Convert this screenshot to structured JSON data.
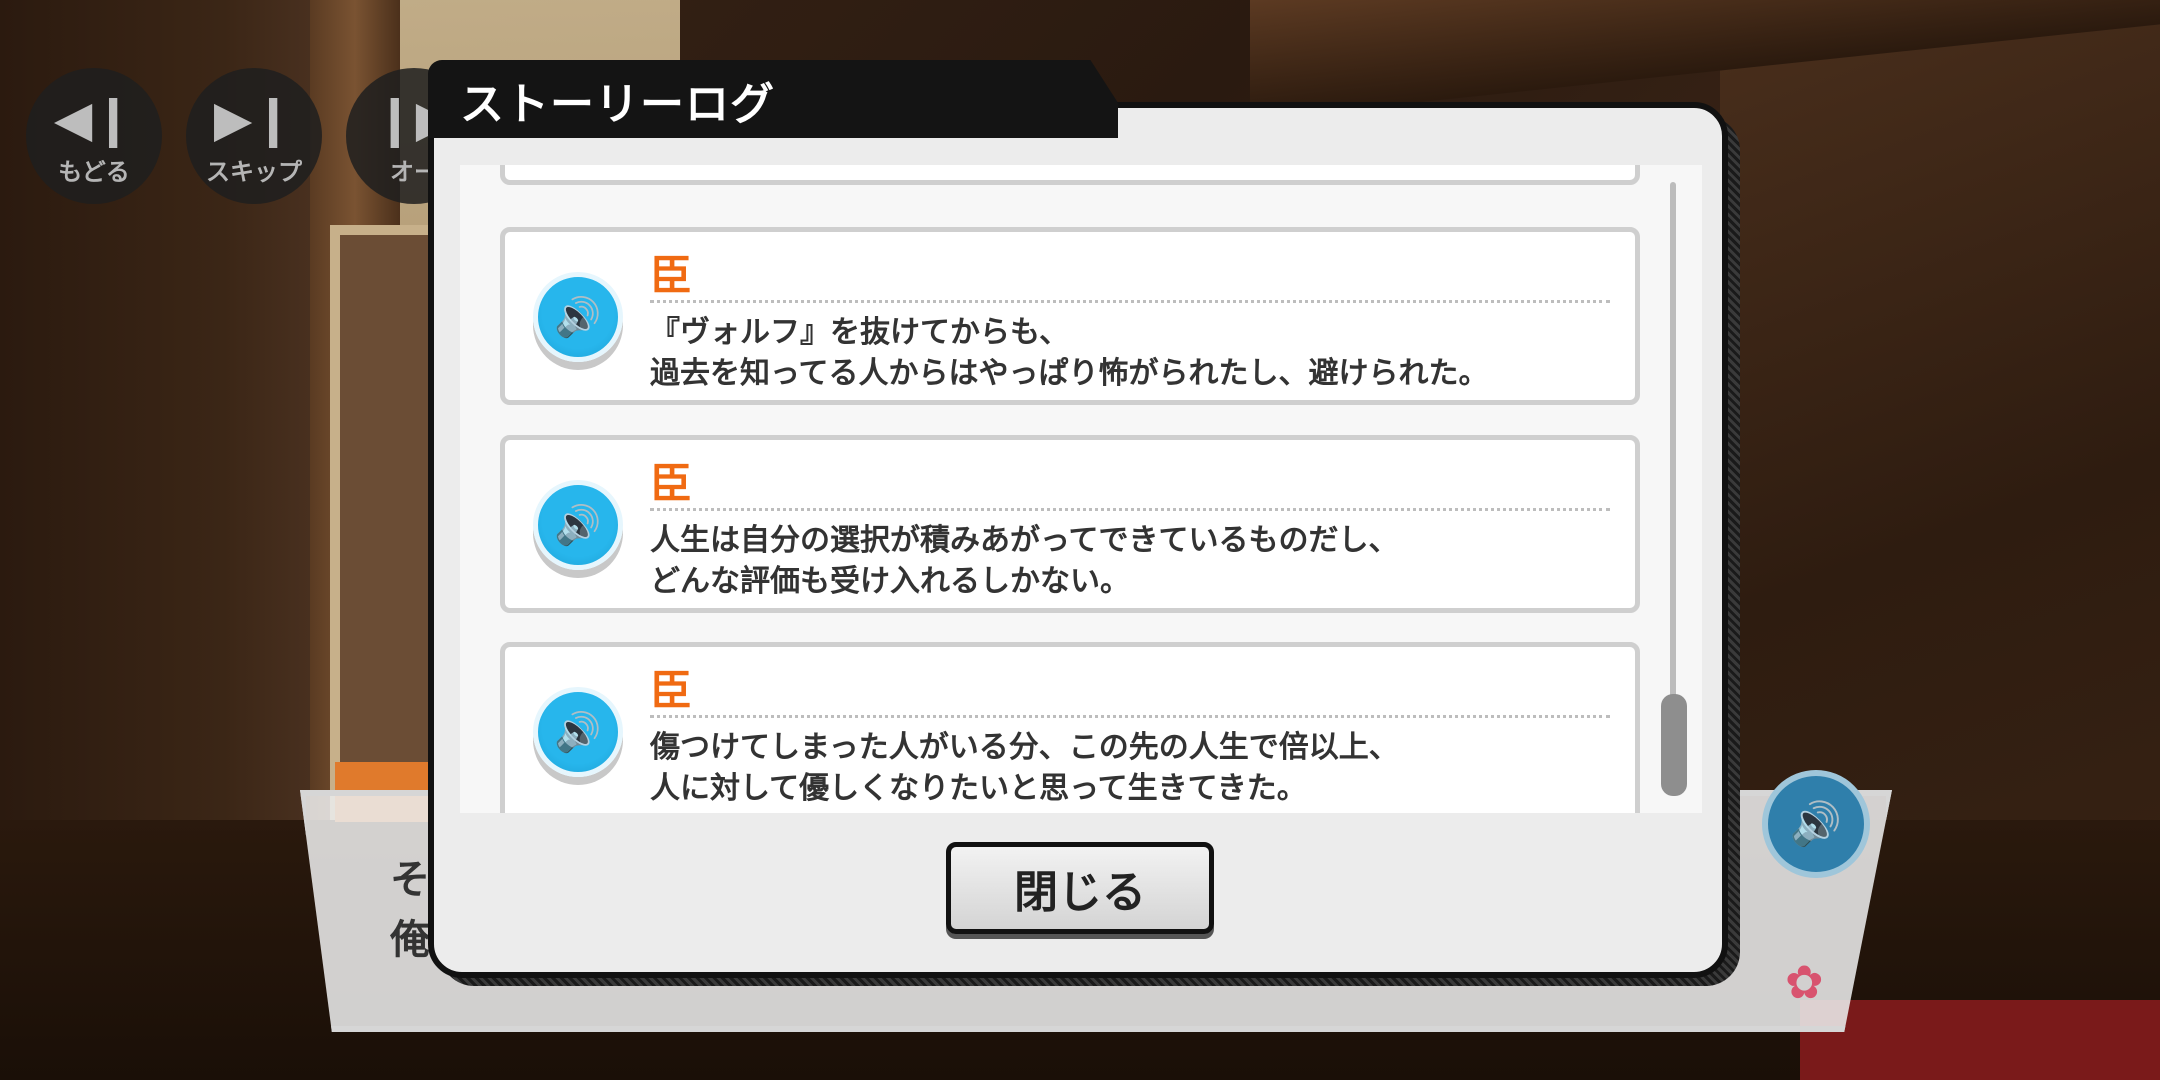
{
  "controls": {
    "back": {
      "icon": "rewind-icon",
      "label": "もどる"
    },
    "skip": {
      "icon": "skip-icon",
      "label": "スキップ"
    },
    "auto": {
      "icon": "play-icon",
      "label": "オー"
    }
  },
  "modal": {
    "title": "ストーリーログ",
    "close_label": "閉じる",
    "entries": [
      {
        "speaker": "臣",
        "line1": "『ヴォルフ』を抜けてからも、",
        "line2": "過去を知ってる人からはやっぱり怖がられたし、避けられた。"
      },
      {
        "speaker": "臣",
        "line1": "人生は自分の選択が積みあがってできているものだし、",
        "line2": "どんな評価も受け入れるしかない。"
      },
      {
        "speaker": "臣",
        "line1": "傷つけてしまった人がいる分、この先の人生で倍以上、",
        "line2": "人に対して優しくなりたいと思って生きてきた。"
      }
    ],
    "scroll_position": 0.92
  },
  "dialogue": {
    "line1": "そ",
    "line2": "俺"
  },
  "colors": {
    "speaker_name": "#f06a12",
    "voice_button": "#27b6ec",
    "title_bar": "#141414"
  }
}
